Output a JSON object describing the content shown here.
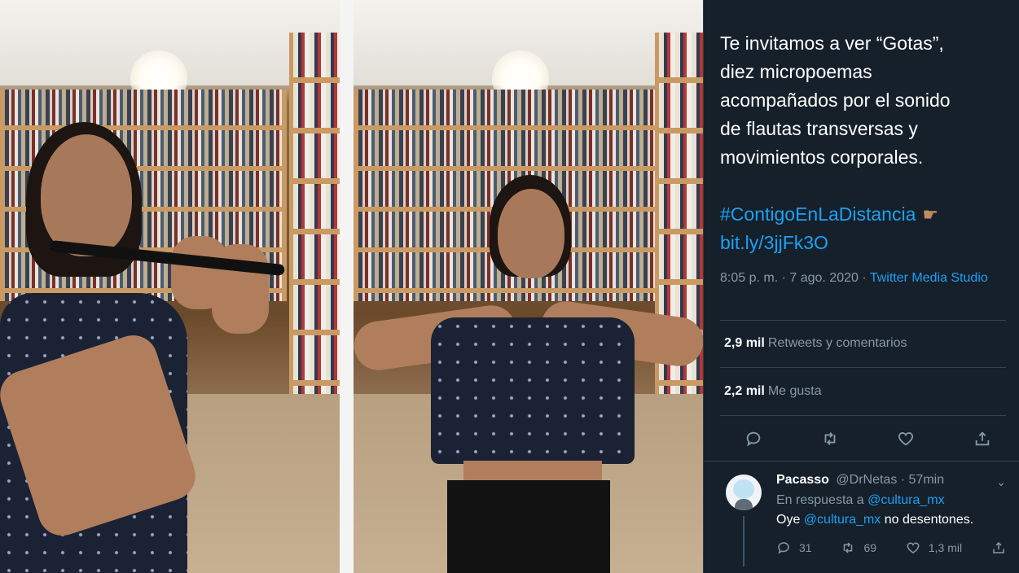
{
  "tweet": {
    "text": "Te invitamos a ver “Gotas”,\ndiez micropoemas\nacompañados por el sonido\nde flautas transversas y\nmovimientos corporales.",
    "hashtag": "#ContigoEnLaDistancia",
    "link": "bit.ly/3jjFk3O",
    "emoji_icon": "pointing-right-hand",
    "timestamp": "8:05 p. m. · 7 ago. 2020 · ",
    "source": "Twitter Media Studio",
    "retweets_count": "2,9 mil",
    "retweets_label": "Retweets y comentarios",
    "likes_count": "2,2 mil",
    "likes_label": "Me gusta",
    "actions": [
      "reply-icon",
      "retweet-icon",
      "like-icon",
      "share-icon"
    ]
  },
  "reply": {
    "name": "Pacasso",
    "handle": "@DrNetas",
    "time": "· 57min",
    "reply_to_prefix": "En respuesta a ",
    "reply_to_mention": "@cultura_mx",
    "body_prefix": "Oye ",
    "body_mention": "@cultura_mx",
    "body_suffix": " no desentones.",
    "reply_count": "31",
    "retweet_count": "69",
    "like_count": "1,3 mil"
  },
  "colors": {
    "background": "#15202b",
    "accent": "#1da1f2",
    "secondary_text": "#8899a6",
    "primary_text": "#ffffff"
  }
}
